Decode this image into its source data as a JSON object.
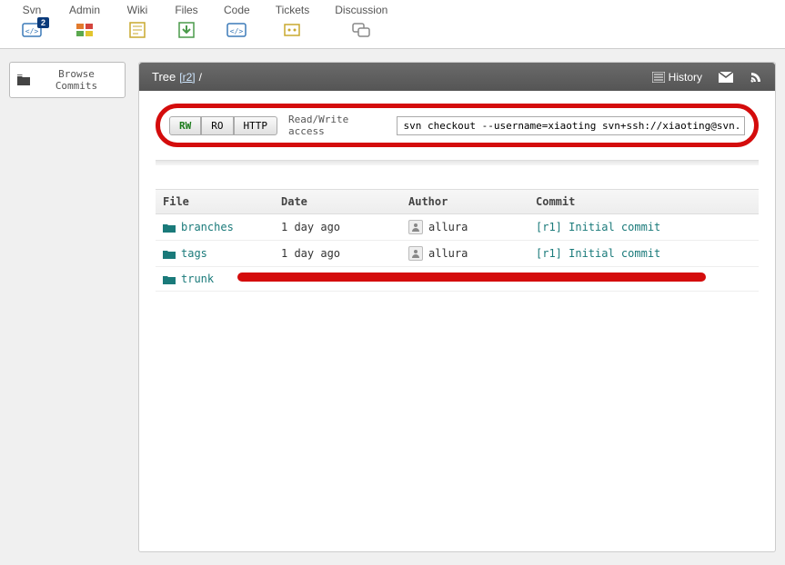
{
  "topnav": [
    {
      "label": "Svn",
      "active": true,
      "badge": "2",
      "icon": "svn"
    },
    {
      "label": "Admin",
      "icon": "admin"
    },
    {
      "label": "Wiki",
      "icon": "wiki"
    },
    {
      "label": "Files",
      "icon": "files"
    },
    {
      "label": "Code",
      "icon": "code"
    },
    {
      "label": "Tickets",
      "icon": "tickets"
    },
    {
      "label": "Discussion",
      "icon": "discussion"
    }
  ],
  "sidebar": {
    "browse_label": "Browse Commits"
  },
  "titlebar": {
    "tree_label": "Tree",
    "revision": "[r2]",
    "slash": "/",
    "history_label": "History"
  },
  "access": {
    "protocols": [
      {
        "label": "RW",
        "active": true
      },
      {
        "label": "RO"
      },
      {
        "label": "HTTP"
      }
    ],
    "desc": "Read/Write access",
    "command": "svn checkout --username=xiaoting svn+ssh://xiaoting@svn.code.sf."
  },
  "listing": {
    "headers": {
      "file": "File",
      "date": "Date",
      "author": "Author",
      "commit": "Commit"
    },
    "rows": [
      {
        "name": "branches",
        "date": "1 day ago",
        "author": "allura",
        "commit": "[r1] Initial commit"
      },
      {
        "name": "tags",
        "date": "1 day ago",
        "author": "allura",
        "commit": "[r1] Initial commit"
      },
      {
        "name": "trunk",
        "date": "",
        "author": "",
        "commit": "",
        "overlay": true
      }
    ]
  }
}
